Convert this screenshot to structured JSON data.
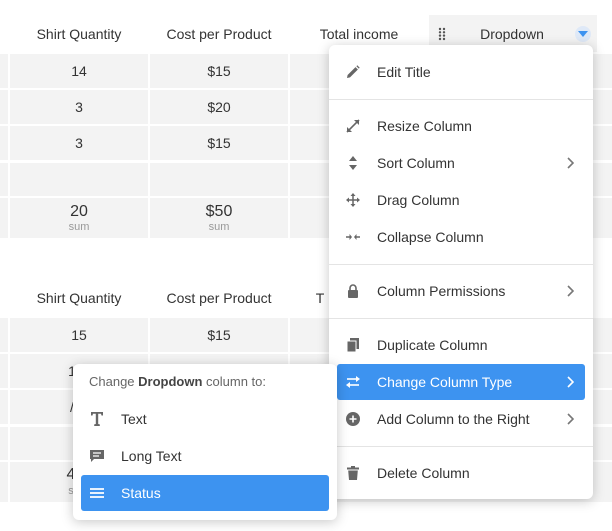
{
  "table1": {
    "headers": [
      "Shirt Quantity",
      "Cost per Product",
      "Total income"
    ],
    "rows": [
      [
        "14",
        "$15"
      ],
      [
        "3",
        "$20"
      ],
      [
        "3",
        "$15"
      ]
    ],
    "sums": [
      {
        "value": "20",
        "label": "sum"
      },
      {
        "value": "$50",
        "label": "sum"
      }
    ],
    "dropdown_header": "Dropdown"
  },
  "table2": {
    "headers": [
      "Shirt Quantity",
      "Cost per Product",
      "T"
    ],
    "rows": [
      [
        "15",
        "$15"
      ]
    ],
    "partial": [
      "1",
      "/",
      "4",
      "s"
    ]
  },
  "menu": {
    "items": [
      {
        "label": "Edit Title",
        "icon": "pencil-icon"
      },
      {
        "label": "Resize Column",
        "icon": "resize-icon"
      },
      {
        "label": "Sort Column",
        "icon": "sort-icon"
      },
      {
        "label": "Drag Column",
        "icon": "move-icon"
      },
      {
        "label": "Collapse Column",
        "icon": "collapse-icon"
      },
      {
        "label": "Column Permissions",
        "icon": "lock-icon"
      },
      {
        "label": "Duplicate Column",
        "icon": "duplicate-icon"
      },
      {
        "label": "Change Column Type",
        "icon": "swap-icon"
      },
      {
        "label": "Add Column to the Right",
        "icon": "add-circle-icon"
      },
      {
        "label": "Delete Column",
        "icon": "trash-icon"
      }
    ]
  },
  "submenu": {
    "title_prefix": "Change ",
    "title_bold": "Dropdown",
    "title_suffix": " column to:",
    "items": [
      {
        "label": "Text",
        "icon": "text-type-icon"
      },
      {
        "label": "Long Text",
        "icon": "comment-icon"
      },
      {
        "label": "Status",
        "icon": "status-lines-icon"
      }
    ]
  },
  "colors": {
    "accent": "#3d93f0",
    "row_bg": "#f3f3f3"
  }
}
